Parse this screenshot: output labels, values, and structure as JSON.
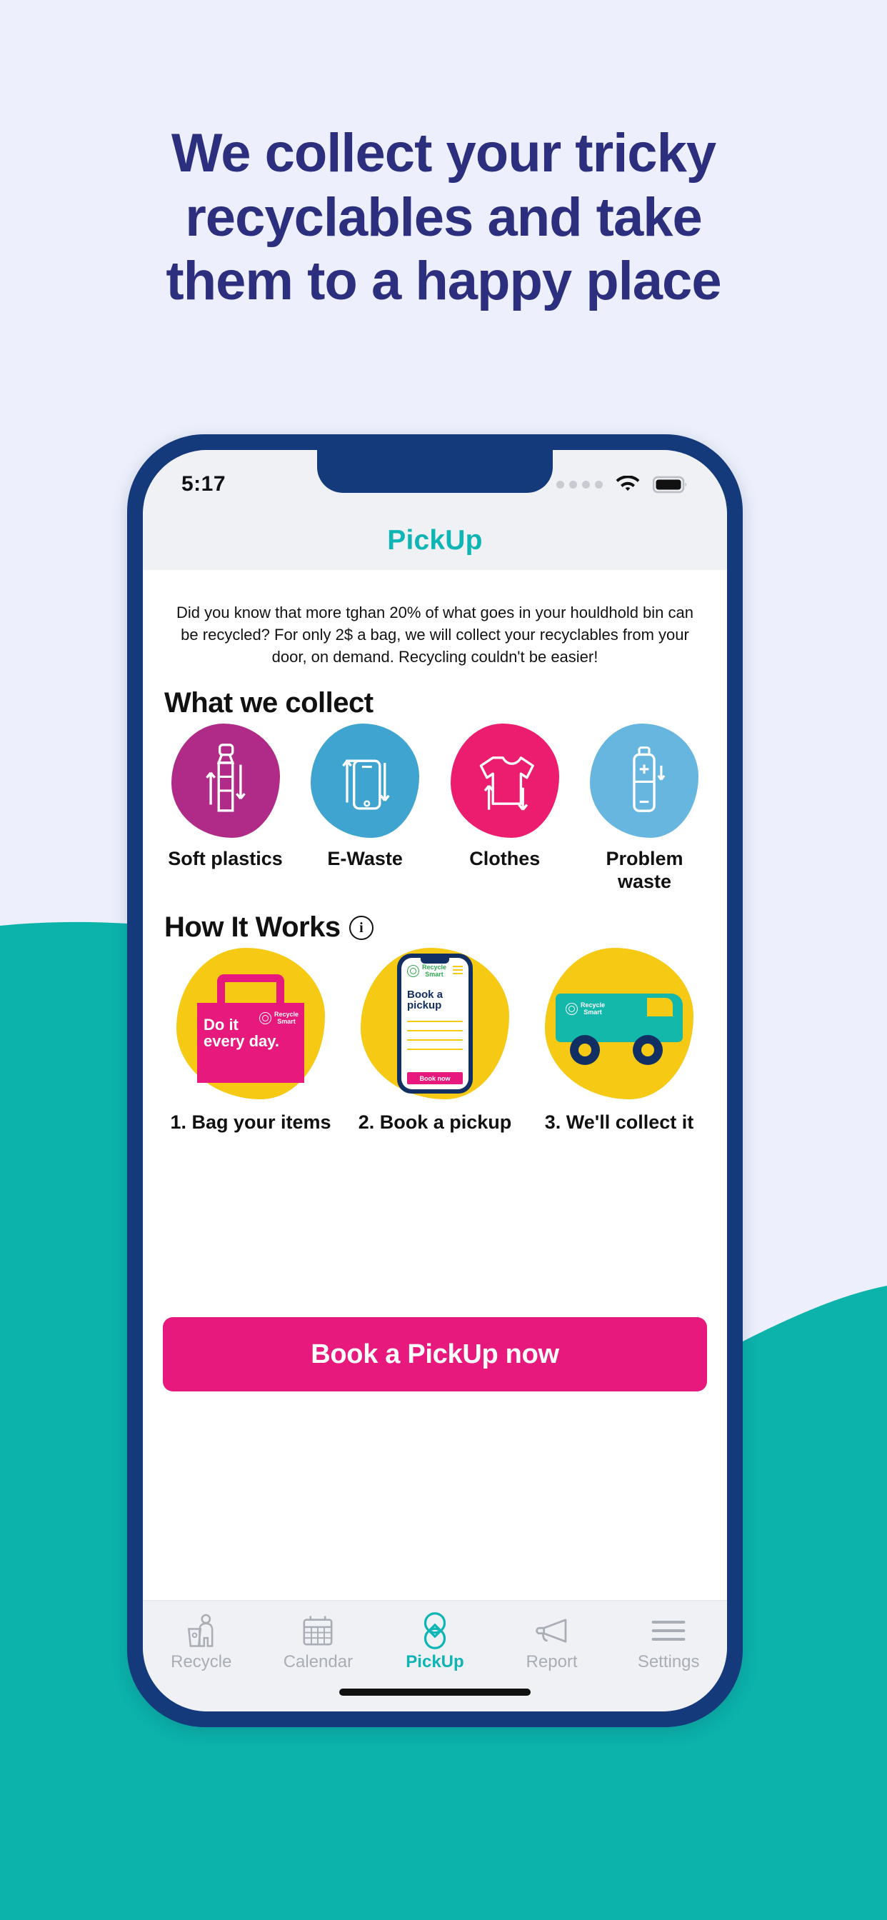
{
  "headline": {
    "line1": "We collect your tricky",
    "line2": "recyclables and take",
    "line3": "them to a happy place"
  },
  "colors": {
    "page_background": "#edf0fc",
    "teal_background": "#0bb3ab",
    "phone_frame": "#143a7b",
    "accent_teal": "#0fb5b5",
    "accent_pink": "#e8197d",
    "accent_yellow": "#f6c915",
    "headline_navy": "#2b2f7e"
  },
  "phone": {
    "statusbar": {
      "time": "5:17",
      "signal_icon": "signal-dots-icon",
      "wifi_icon": "wifi-icon",
      "battery_icon": "battery-full-icon"
    },
    "header": {
      "title": "PickUp"
    },
    "intro_paragraph": "Did you know that more tghan 20% of what goes in your houldhold bin can be recycled? For only 2$ a bag, we will collect your recyclables from your door, on demand. Recycling couldn't be easier!",
    "collect_section": {
      "title": "What we collect",
      "items": [
        {
          "label": "Soft plastics",
          "icon": "bottle-recycle-icon",
          "color": "#b02a87"
        },
        {
          "label": "E-Waste",
          "icon": "phone-recycle-icon",
          "color": "#3fa4cf"
        },
        {
          "label": "Clothes",
          "icon": "tshirt-recycle-icon",
          "color": "#ec1d6f"
        },
        {
          "label": "Problem waste",
          "icon": "battery-recycle-icon",
          "color": "#66b6e0"
        }
      ]
    },
    "how_section": {
      "title": "How It Works",
      "info_icon": "info-icon",
      "info_glyph": "i",
      "steps": [
        {
          "label": "1. Bag your items",
          "art": "pink-bag-art",
          "art_text_line1": "Do it",
          "art_text_line2": "every day.",
          "brand_line1": "Recycle",
          "brand_line2": "Smart"
        },
        {
          "label": "2. Book a pickup",
          "art": "mini-phone-art",
          "art_title_line1": "Book a",
          "art_title_line2": "pickup",
          "art_button": "Book now",
          "brand_line1": "Recycle",
          "brand_line2": "Smart"
        },
        {
          "label": "3. We'll collect it",
          "art": "truck-art",
          "brand_line1": "Recycle",
          "brand_line2": "Smart"
        }
      ]
    },
    "cta_button": "Book a PickUp now",
    "tabbar": {
      "items": [
        {
          "label": "Recycle",
          "icon": "person-bin-icon",
          "active": false
        },
        {
          "label": "Calendar",
          "icon": "calendar-icon",
          "active": false
        },
        {
          "label": "PickUp",
          "icon": "pickup-loop-icon",
          "active": true
        },
        {
          "label": "Report",
          "icon": "megaphone-icon",
          "active": false
        },
        {
          "label": "Settings",
          "icon": "hamburger-icon",
          "active": false
        }
      ]
    }
  }
}
